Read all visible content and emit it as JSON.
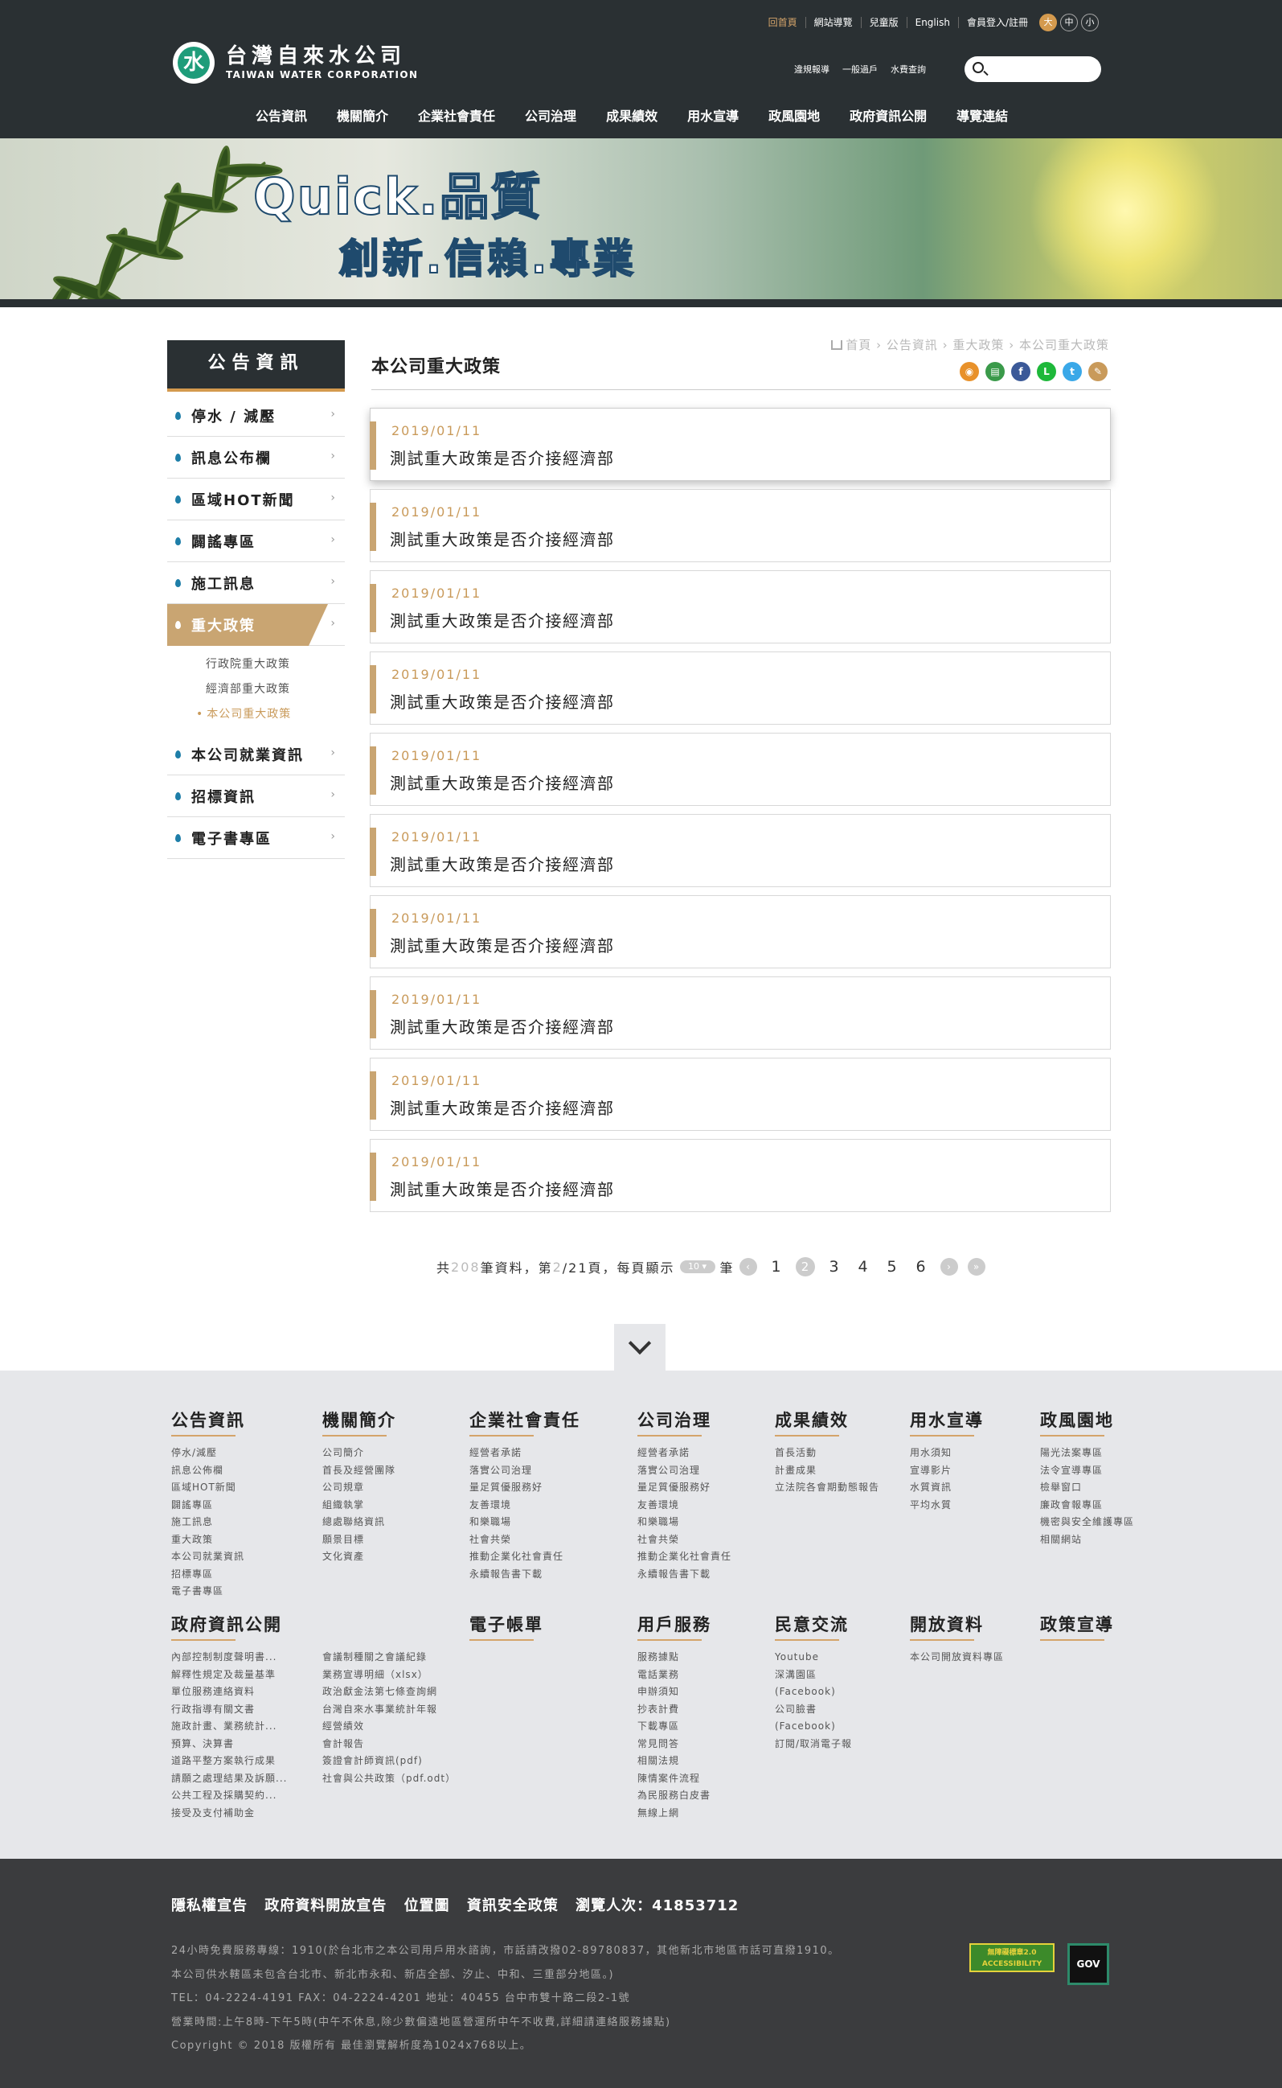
{
  "header": {
    "logo_cn": "台灣自來水公司",
    "logo_en": "TAIWAN WATER CORPORATION",
    "top_links": [
      "回首頁",
      "網站導覽",
      "兒童版",
      "English",
      "會員登入/註冊"
    ],
    "font_sizes": [
      "大",
      "中",
      "小"
    ],
    "sub_links": [
      "違規報導",
      "一般過戶",
      "水費查詢"
    ],
    "search_placeholder": "",
    "nav": [
      "公告資訊",
      "機關簡介",
      "企業社會責任",
      "公司治理",
      "成果績效",
      "用水宣導",
      "政風園地",
      "政府資訊公開",
      "導覽連結"
    ]
  },
  "banner": {
    "title1": "Quick.品質",
    "title2": "創新.信賴.專業"
  },
  "sidebar": {
    "title": "公告資訊",
    "items": [
      "停水 / 減壓",
      "訊息公布欄",
      "區域HOT新聞",
      "闢謠專區",
      "施工訊息",
      "重大政策",
      "本公司就業資訊",
      "招標資訊",
      "電子書專區"
    ],
    "active_index": 5,
    "sub_items": [
      "行政院重大政策",
      "經濟部重大政策",
      "本公司重大政策"
    ]
  },
  "content": {
    "breadcrumb": [
      "首頁",
      "公告資訊",
      "重大政策",
      "本公司重大政策"
    ],
    "page_title": "本公司重大政策",
    "share_icons": [
      "rss-icon",
      "print-icon",
      "facebook-icon",
      "line-icon",
      "twitter-icon",
      "edit-icon"
    ],
    "news": [
      {
        "date": "2019/01/11",
        "title": "測試重大政策是否介接經濟部"
      },
      {
        "date": "2019/01/11",
        "title": "測試重大政策是否介接經濟部"
      },
      {
        "date": "2019/01/11",
        "title": "測試重大政策是否介接經濟部"
      },
      {
        "date": "2019/01/11",
        "title": "測試重大政策是否介接經濟部"
      },
      {
        "date": "2019/01/11",
        "title": "測試重大政策是否介接經濟部"
      },
      {
        "date": "2019/01/11",
        "title": "測試重大政策是否介接經濟部"
      },
      {
        "date": "2019/01/11",
        "title": "測試重大政策是否介接經濟部"
      },
      {
        "date": "2019/01/11",
        "title": "測試重大政策是否介接經濟部"
      },
      {
        "date": "2019/01/11",
        "title": "測試重大政策是否介接經濟部"
      },
      {
        "date": "2019/01/11",
        "title": "測試重大政策是否介接經濟部"
      }
    ],
    "pager": {
      "prefix": "共",
      "total": "208",
      "mid1": "筆資料，第",
      "current": "2",
      "mid2": "/21頁，每頁顯示",
      "per_page": "10",
      "suffix": "筆",
      "pages": [
        "1",
        "2",
        "3",
        "4",
        "5",
        "6"
      ],
      "current_page": "2"
    }
  },
  "sitemap": {
    "row1": [
      {
        "head": "公告資訊",
        "links": [
          "停水/減壓",
          "訊息公佈欄",
          "區域HOT新聞",
          "闢謠專區",
          "施工訊息",
          "重大政策",
          "本公司就業資訊",
          "招標專區",
          "電子書專區"
        ]
      },
      {
        "head": "機關簡介",
        "links": [
          "公司簡介",
          "首長及經營團隊",
          "公司規章",
          "組織執掌",
          "總處聯絡資訊",
          "願景目標",
          "文化資產"
        ]
      },
      {
        "head": "企業社會責任",
        "links": [
          "經營者承諾",
          "落實公司治理",
          "量足質優服務好",
          "友善環境",
          "和樂職場",
          "社會共榮",
          "推動企業化社會責任",
          "永續報告書下載"
        ]
      },
      {
        "head": "公司治理",
        "links": [
          "經營者承諾",
          "落實公司治理",
          "量足質優服務好",
          "友善環境",
          "和樂職場",
          "社會共榮",
          "推動企業化社會責任",
          "永續報告書下載"
        ]
      },
      {
        "head": "成果績效",
        "links": [
          "首長活動",
          "計畫成果",
          "立法院各會期動態報告"
        ]
      },
      {
        "head": "用水宣導",
        "links": [
          "用水須知",
          "宣導影片",
          "水質資訊",
          "平均水質"
        ]
      },
      {
        "head": "政風園地",
        "links": [
          "陽光法案專區",
          "法令宣導專區",
          "檢舉窗口",
          "廉政會報專區",
          "機密與安全維護專區",
          "相關網站"
        ]
      }
    ],
    "row2": [
      {
        "head": "政府資訊公開",
        "links": [
          "內部控制制度聲明書...",
          "解釋性規定及裁量基準",
          "單位服務連絡資料",
          "行政指導有關文書",
          "施政計畫、業務統計...",
          "預算、決算書",
          "道路平整方案執行成果",
          "請願之處理結果及訴願...",
          "公共工程及採購契約...",
          "接受及支付補助金"
        ]
      },
      {
        "head": "",
        "links": [
          "會議制種關之會議紀錄",
          "業務宣導明細（xlsx）",
          "政治獻金法第七條查詢網",
          "台灣自來水事業統計年報",
          "經營績效",
          "會計報告",
          "簽證會計師資訊(pdf)",
          "社會與公共政策（pdf.odt）"
        ]
      },
      {
        "head": "電子帳單",
        "links": []
      },
      {
        "head": "用戶服務",
        "links": [
          "服務據點",
          "電話業務",
          "申辦須知",
          "抄表計費",
          "下載專區",
          "常見問答",
          "相關法規",
          "陳情案件流程",
          "為民服務白皮書",
          "無線上網"
        ]
      },
      {
        "head": "民意交流",
        "links": [
          "Youtube",
          "深溝園區",
          "(Facebook)",
          "公司臉書",
          "(Facebook)",
          "訂閱/取消電子報"
        ]
      },
      {
        "head": "開放資料",
        "links": [
          "本公司開放資料專區"
        ]
      },
      {
        "head": "政策宣導",
        "links": []
      }
    ]
  },
  "footer": {
    "links": [
      "隱私權宣告",
      "政府資料開放宣告",
      "位置圖",
      "資訊安全政策",
      "瀏覽人次：41853712"
    ],
    "info": [
      "24小時免費服務專線：1910(於台北市之本公司用戶用水諮詢，市話請改撥02-89780837，其他新北市地區市話可直撥1910。",
      "本公司供水轄區未包含台北市、新北市永和、新店全部、汐止、中和、三重部分地區。)",
      "TEL：04-2224-4191   FAX：04-2224-4201   地址：40455 台中市雙十路二段2-1號",
      "營業時間:上午8時-下午5時(中午不休息,除少數偏遠地區營運所中午不收費,詳細請連絡服務據點)",
      "Copyright © 2018 版權所有 最佳瀏覽解析度為1024x768以上。"
    ],
    "badge_accessibility": "無障礙標章2.0 ACCESSIBILITY",
    "badge_gov": "GOV"
  },
  "colors": {
    "header_bg": "#2a3033",
    "accent": "#c9a572",
    "date_color": "#c99a5a",
    "footer_bg": "#3b3c3e",
    "sitemap_bg": "#e6e7ea"
  }
}
